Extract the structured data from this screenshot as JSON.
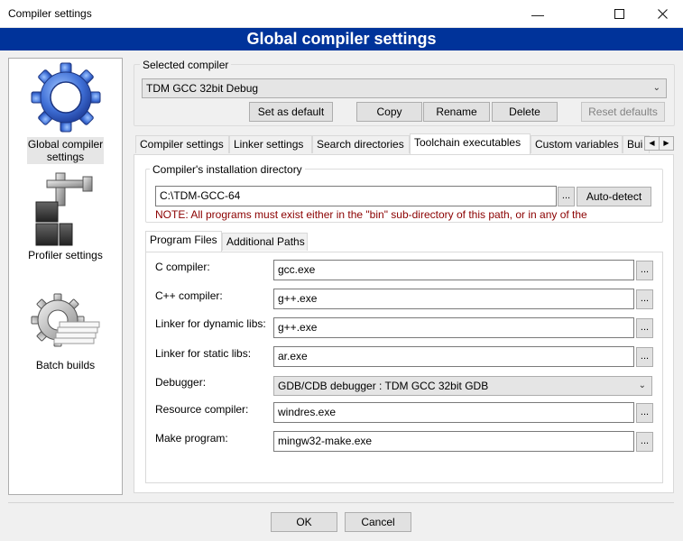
{
  "window": {
    "title": "Compiler settings",
    "banner": "Global compiler settings"
  },
  "sidebar": {
    "items": [
      {
        "label": "Global compiler settings",
        "icon": "gear-icon"
      },
      {
        "label": "Profiler settings",
        "icon": "profiler-icon"
      },
      {
        "label": "Batch builds",
        "icon": "batch-builds-icon"
      }
    ]
  },
  "compiler": {
    "group_label": "Selected compiler",
    "selected": "TDM GCC 32bit Debug",
    "buttons": {
      "set_default": "Set as default",
      "copy": "Copy",
      "rename": "Rename",
      "delete": "Delete",
      "reset_defaults": "Reset defaults"
    }
  },
  "tabs": [
    {
      "label": "Compiler settings"
    },
    {
      "label": "Linker settings"
    },
    {
      "label": "Search directories"
    },
    {
      "label": "Toolchain executables"
    },
    {
      "label": "Custom variables"
    },
    {
      "label": "Bui"
    }
  ],
  "toolchain": {
    "install_dir_label": "Compiler's installation directory",
    "install_dir": "C:\\TDM-GCC-64",
    "browse": "...",
    "auto_detect": "Auto-detect",
    "note": "NOTE: All programs must exist either in the \"bin\" sub-directory of this path, or in any of the",
    "subtabs": [
      {
        "label": "Program Files"
      },
      {
        "label": "Additional Paths"
      }
    ],
    "fields": {
      "c_compiler": {
        "label": "C compiler:",
        "value": "gcc.exe"
      },
      "cpp_compiler": {
        "label": "C++ compiler:",
        "value": "g++.exe"
      },
      "linker_dynamic": {
        "label": "Linker for dynamic libs:",
        "value": "g++.exe"
      },
      "linker_static": {
        "label": "Linker for static libs:",
        "value": "ar.exe"
      },
      "debugger": {
        "label": "Debugger:",
        "value": "GDB/CDB debugger : TDM GCC 32bit GDB"
      },
      "resource_compiler": {
        "label": "Resource compiler:",
        "value": "windres.exe"
      },
      "make_program": {
        "label": "Make program:",
        "value": "mingw32-make.exe"
      }
    }
  },
  "footer": {
    "ok": "OK",
    "cancel": "Cancel"
  },
  "colors": {
    "banner": "#00339a"
  }
}
